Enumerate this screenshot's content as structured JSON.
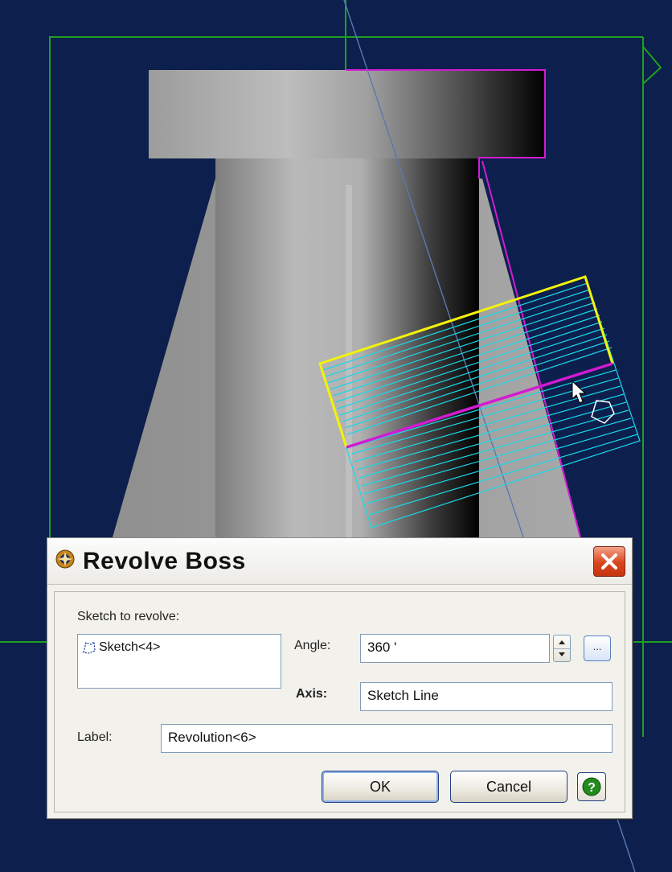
{
  "dialog": {
    "title": "Revolve Boss",
    "sketch_to_revolve_label": "Sketch to revolve:",
    "sketch_item": "Sketch<4>",
    "angle_label": "Angle:",
    "angle_value": "360 '",
    "axis_label": "Axis:",
    "axis_value": "Sketch Line",
    "label_label": "Label:",
    "label_value": "Revolution<6>",
    "ok_label": "OK",
    "cancel_label": "Cancel",
    "more_label": "...",
    "help_icon": "question-icon",
    "close_icon": "close-x-icon"
  },
  "viewport": {
    "background": "#0c1f4d",
    "bounding_box_color": "#1fa01f",
    "highlight_edge_color": "#d31ad3",
    "profile_color": "#f3f30a",
    "preview_color": "#18d8e8"
  }
}
